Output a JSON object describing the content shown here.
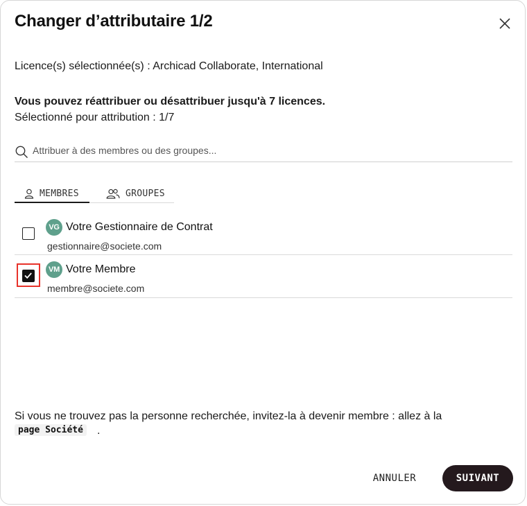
{
  "dialog": {
    "title": "Changer d’attributaire 1/2",
    "close_label": "×"
  },
  "licenses": {
    "selected_text": "Licence(s) sélectionnée(s) : Archicad Collaborate, International"
  },
  "info": {
    "limit_text": "Vous pouvez réattribuer ou désattribuer jusqu'à 7 licences.",
    "selected_count_text": "Sélectionné pour attribution : 1/7"
  },
  "search": {
    "placeholder": "Attribuer à des membres ou des groupes...",
    "value": "",
    "icon": "search-icon"
  },
  "tabs": [
    {
      "label": "MEMBRES",
      "icon": "user-icon",
      "active": true
    },
    {
      "label": "GROUPES",
      "icon": "users-icon",
      "active": false
    }
  ],
  "members": [
    {
      "initials": "VG",
      "name": "Votre Gestionnaire de Contrat",
      "email": "gestionnaire@societe.com",
      "checked": false
    },
    {
      "initials": "VM",
      "name": "Votre Membre",
      "email": "membre@societe.com",
      "checked": true
    }
  ],
  "hint": {
    "text": "Si vous ne trouvez pas la personne recherchée, invitez-la à devenir membre : allez à la",
    "link_label": "page Société",
    "suffix": "."
  },
  "footer": {
    "cancel_label": "ANNULER",
    "next_label": "SUIVANT"
  },
  "colors": {
    "avatar": "#5fa08c",
    "primary_button": "#24191d",
    "highlight": "#e8322a"
  }
}
